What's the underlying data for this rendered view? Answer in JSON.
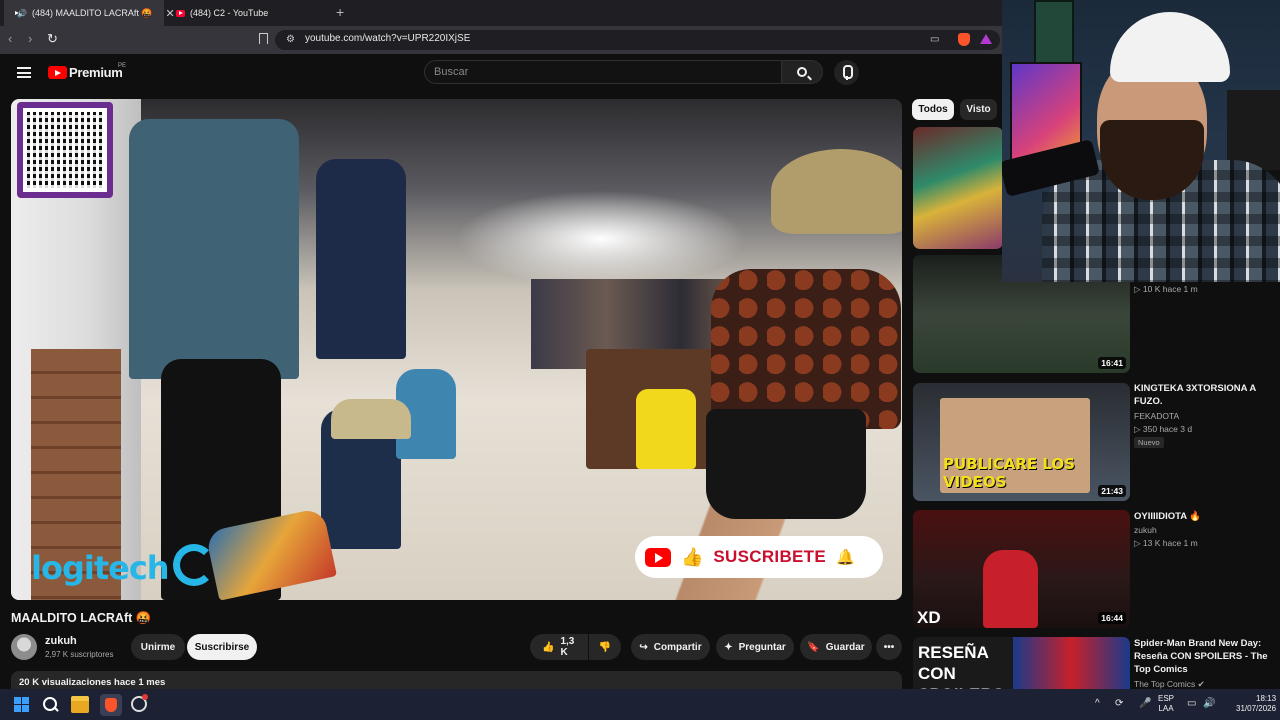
{
  "browser": {
    "tabs": [
      {
        "label": "(484) MAALDITO LACRAft 🤬",
        "active": true
      },
      {
        "label": "(484) C2 - YouTube",
        "active": false
      }
    ],
    "url": "youtube.com/watch?v=UPR220IXjSE",
    "colors": {
      "tab_bg": "#1f1f23",
      "active_tab": "#35353b"
    }
  },
  "header": {
    "logo_text": "Premium",
    "country": "PE",
    "search_placeholder": "Buscar"
  },
  "player": {
    "cta_text": "SUSCRIBETE",
    "overlay_brand": "logitech"
  },
  "video": {
    "title": "MAALDITO LACRAft 🤬",
    "channel": "zukuh",
    "subscribers": "2,97 K suscriptores",
    "join_label": "Unirme",
    "subscribe_label": "Suscribirse",
    "likes": "1,3 K",
    "share_label": "Compartir",
    "ask_label": "Preguntar",
    "save_label": "Guardar",
    "views_line": "20 K visualizaciones  hace 1 mes"
  },
  "sidebar": {
    "chips": [
      "Todos",
      "Visto"
    ],
    "items": [
      {
        "title": "",
        "channel": "",
        "stats": "▷ 10 K  hace 1 m",
        "duration": ""
      },
      {
        "title": "",
        "channel": "",
        "stats": "",
        "duration": "16:41"
      },
      {
        "title": "KINGTEKA 3XTORSIONA A FUZO.",
        "channel": "FEKADOTA",
        "stats": "▷ 350  hace 3 d",
        "badge": "Nuevo",
        "duration": "21:43"
      },
      {
        "title": "OYIIIIDIOTA 🔥",
        "channel": "zukuh",
        "stats": "▷ 13 K  hace 1 m",
        "duration": "16:44"
      },
      {
        "title": "Spider-Man Brand New Day: Reseña CON SPOILERS - The Top Comics",
        "channel": "The Top Comics ✔",
        "stats": "",
        "duration": ""
      }
    ],
    "thumb_texts": {
      "t3_caption": "PUBLICARE LOS VIDEOS",
      "t5_caption": "RESEÑA CON SPOILERS",
      "t4_caption": "XD"
    }
  },
  "taskbar": {
    "lang_1": "ESP",
    "lang_2": "LAA",
    "time": "18:13",
    "date": "31/07/2026"
  }
}
